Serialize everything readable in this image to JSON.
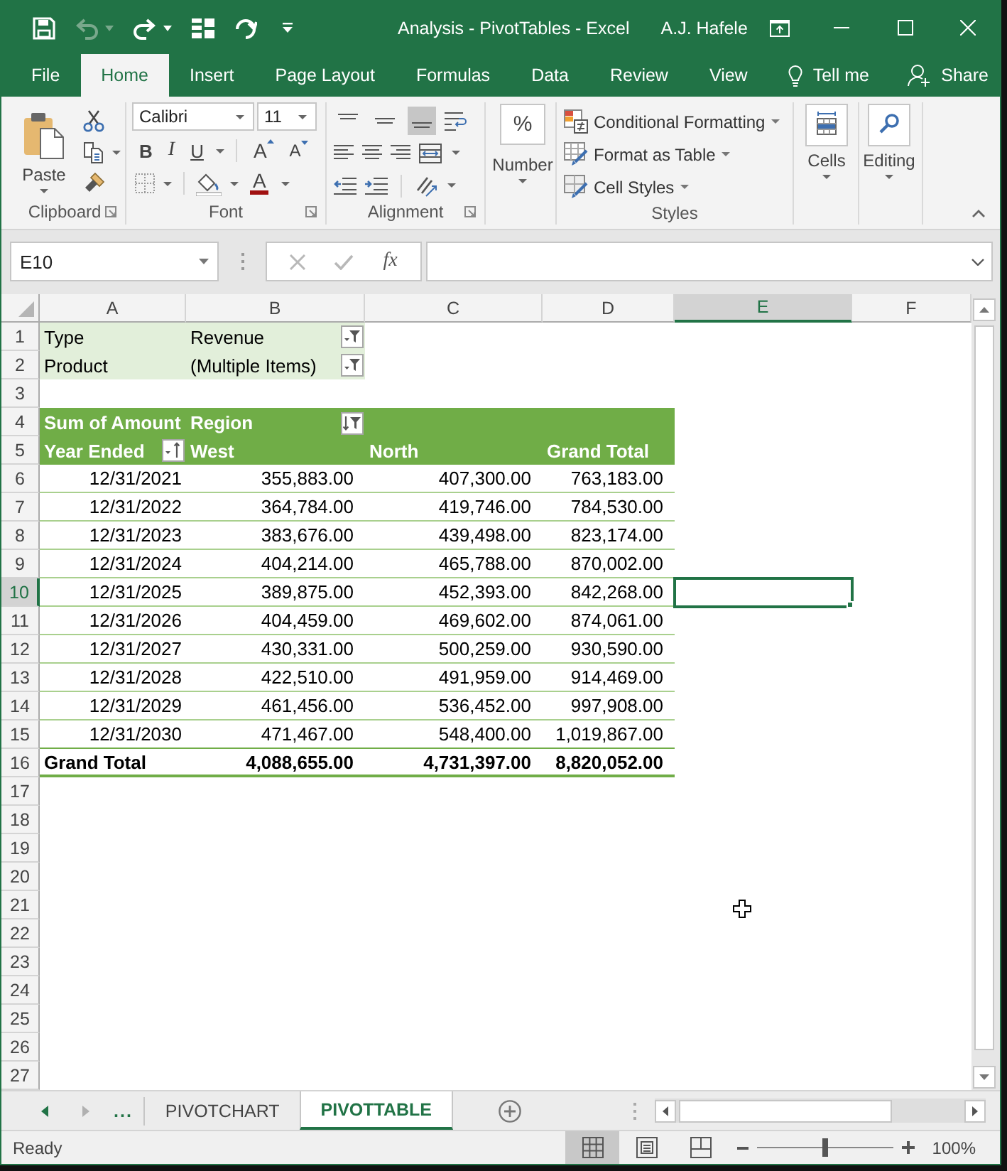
{
  "window": {
    "title": "Analysis - PivotTables - Excel",
    "user": "A.J. Hafele"
  },
  "quick_access": [
    {
      "kind": "save",
      "disabled": false
    },
    {
      "kind": "undo",
      "disabled": true
    },
    {
      "kind": "redo",
      "disabled": false
    },
    {
      "kind": "grid",
      "disabled": false
    },
    {
      "kind": "repeat",
      "disabled": false
    }
  ],
  "ribbon_tabs": [
    {
      "label": "File",
      "selected": false
    },
    {
      "label": "Home",
      "selected": true
    },
    {
      "label": "Insert",
      "selected": false
    },
    {
      "label": "Page Layout",
      "selected": false
    },
    {
      "label": "Formulas",
      "selected": false
    },
    {
      "label": "Data",
      "selected": false
    },
    {
      "label": "Review",
      "selected": false
    },
    {
      "label": "View",
      "selected": false
    }
  ],
  "tell_me": "Tell me",
  "share": "Share",
  "ribbon": {
    "clipboard": {
      "label": "Clipboard",
      "paste": "Paste"
    },
    "font": {
      "label": "Font",
      "font_name": "Calibri",
      "font_size": "11",
      "bold": "B",
      "italic": "I",
      "underline": "U",
      "grow": "A",
      "shrink": "A",
      "font_color_letter": "A"
    },
    "alignment": {
      "label": "Alignment",
      "vertical": [
        {
          "kind": "top",
          "selected": false
        },
        {
          "kind": "middle",
          "selected": false
        },
        {
          "kind": "bottom",
          "selected": true
        }
      ]
    },
    "number": {
      "label": "Number",
      "symbol": "%"
    },
    "styles": {
      "label": "Styles",
      "commands": [
        {
          "kind": "conditional",
          "label": "Conditional Formatting"
        },
        {
          "kind": "table",
          "label": "Format as Table"
        },
        {
          "kind": "cell_styles",
          "label": "Cell Styles"
        }
      ]
    },
    "cells": {
      "label": "Cells"
    },
    "editing": {
      "label": "Editing"
    }
  },
  "formula_bar": {
    "name_box": "E10",
    "editing": false,
    "function_label": "fx"
  },
  "sheet": {
    "columns": [
      {
        "label": "A",
        "selected": false
      },
      {
        "label": "B",
        "selected": false
      },
      {
        "label": "C",
        "selected": false
      },
      {
        "label": "D",
        "selected": false
      },
      {
        "label": "E",
        "selected": true
      },
      {
        "label": "F",
        "selected": false
      }
    ],
    "row_numbers": [
      {
        "label": "1",
        "selected": false
      },
      {
        "label": "2",
        "selected": false
      },
      {
        "label": "3",
        "selected": false
      },
      {
        "label": "4",
        "selected": false
      },
      {
        "label": "5",
        "selected": false
      },
      {
        "label": "6",
        "selected": false
      },
      {
        "label": "7",
        "selected": false
      },
      {
        "label": "8",
        "selected": false
      },
      {
        "label": "9",
        "selected": false
      },
      {
        "label": "10",
        "selected": true
      },
      {
        "label": "11",
        "selected": false
      },
      {
        "label": "12",
        "selected": false
      },
      {
        "label": "13",
        "selected": false
      },
      {
        "label": "14",
        "selected": false
      },
      {
        "label": "15",
        "selected": false
      },
      {
        "label": "16",
        "selected": false
      },
      {
        "label": "17",
        "selected": false
      },
      {
        "label": "18",
        "selected": false
      },
      {
        "label": "19",
        "selected": false
      },
      {
        "label": "20",
        "selected": false
      },
      {
        "label": "21",
        "selected": false
      },
      {
        "label": "22",
        "selected": false
      },
      {
        "label": "23",
        "selected": false
      },
      {
        "label": "24",
        "selected": false
      },
      {
        "label": "25",
        "selected": false
      },
      {
        "label": "26",
        "selected": false
      },
      {
        "label": "27",
        "selected": false
      }
    ]
  },
  "pivot": {
    "filters": [
      {
        "field": "Type",
        "value": "Revenue"
      },
      {
        "field": "Product",
        "value": "(Multiple Items)"
      }
    ],
    "data_field": "Sum of Amount",
    "column_field": "Region",
    "row_field": "Year Ended",
    "columns": [
      "West",
      "North",
      "Grand Total"
    ],
    "rows": [
      {
        "label": "12/31/2021",
        "values": [
          "355,883.00",
          "407,300.00",
          "763,183.00"
        ]
      },
      {
        "label": "12/31/2022",
        "values": [
          "364,784.00",
          "419,746.00",
          "784,530.00"
        ]
      },
      {
        "label": "12/31/2023",
        "values": [
          "383,676.00",
          "439,498.00",
          "823,174.00"
        ]
      },
      {
        "label": "12/31/2024",
        "values": [
          "404,214.00",
          "465,788.00",
          "870,002.00"
        ]
      },
      {
        "label": "12/31/2025",
        "values": [
          "389,875.00",
          "452,393.00",
          "842,268.00"
        ]
      },
      {
        "label": "12/31/2026",
        "values": [
          "404,459.00",
          "469,602.00",
          "874,061.00"
        ]
      },
      {
        "label": "12/31/2027",
        "values": [
          "430,331.00",
          "500,259.00",
          "930,590.00"
        ]
      },
      {
        "label": "12/31/2028",
        "values": [
          "422,510.00",
          "491,959.00",
          "914,469.00"
        ]
      },
      {
        "label": "12/31/2029",
        "values": [
          "461,456.00",
          "536,452.00",
          "997,908.00"
        ]
      },
      {
        "label": "12/31/2030",
        "values": [
          "471,467.00",
          "548,400.00",
          "1,019,867.00"
        ]
      }
    ],
    "grand_total": {
      "label": "Grand Total",
      "values": [
        "4,088,655.00",
        "4,731,397.00",
        "8,820,052.00"
      ]
    }
  },
  "sheet_tabs": {
    "overflow": "...",
    "tabs": [
      {
        "label": "PIVOTCHART",
        "selected": false
      },
      {
        "label": "PIVOTTABLE",
        "selected": true
      }
    ]
  },
  "status_bar": {
    "status": "Ready",
    "views": [
      {
        "kind": "normal",
        "selected": true
      },
      {
        "kind": "page_layout",
        "selected": false
      },
      {
        "kind": "page_break_preview",
        "selected": false
      }
    ],
    "zoom": {
      "level": 0.5,
      "label": "100%"
    }
  }
}
